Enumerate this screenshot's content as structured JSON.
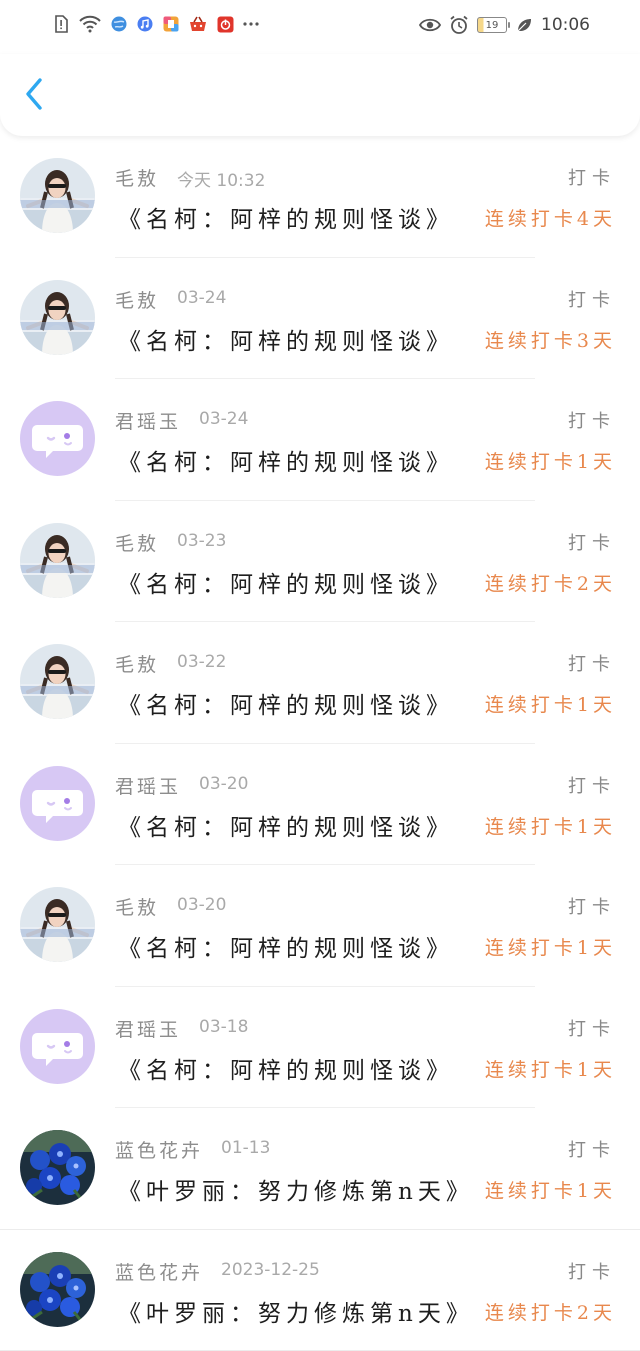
{
  "status_bar": {
    "left_icons": [
      "alert-icon",
      "wifi-icon",
      "globe-app-icon",
      "music-app-icon",
      "app-icon",
      "basket-app-icon",
      "netease-music-icon",
      "more-dots-icon"
    ],
    "right_icons": [
      "eye-icon",
      "alarm-icon",
      "battery-icon",
      "leaf-icon"
    ],
    "battery_level": "19",
    "time": "10:06"
  },
  "nav": {
    "back_icon": "chevron-left-icon",
    "accent_color": "#2ea8f0"
  },
  "colors": {
    "streak": "#e8884d",
    "name": "#8d8d8d",
    "title": "#1e1e1e"
  },
  "items": [
    {
      "user": "毛敖",
      "time": "今天 10:32",
      "label": "打卡",
      "title": "《名柯：阿梓的规则怪谈》",
      "streak": "连续打卡4天",
      "avatar": "photo-girl"
    },
    {
      "user": "毛敖",
      "time": "03-24",
      "label": "打卡",
      "title": "《名柯：阿梓的规则怪谈》",
      "streak": "连续打卡3天",
      "avatar": "photo-girl"
    },
    {
      "user": "君瑶玉",
      "time": "03-24",
      "label": "打卡",
      "title": "《名柯：阿梓的规则怪谈》",
      "streak": "连续打卡1天",
      "avatar": "default-chat"
    },
    {
      "user": "毛敖",
      "time": "03-23",
      "label": "打卡",
      "title": "《名柯：阿梓的规则怪谈》",
      "streak": "连续打卡2天",
      "avatar": "photo-girl"
    },
    {
      "user": "毛敖",
      "time": "03-22",
      "label": "打卡",
      "title": "《名柯：阿梓的规则怪谈》",
      "streak": "连续打卡1天",
      "avatar": "photo-girl"
    },
    {
      "user": "君瑶玉",
      "time": "03-20",
      "label": "打卡",
      "title": "《名柯：阿梓的规则怪谈》",
      "streak": "连续打卡1天",
      "avatar": "default-chat"
    },
    {
      "user": "毛敖",
      "time": "03-20",
      "label": "打卡",
      "title": "《名柯：阿梓的规则怪谈》",
      "streak": "连续打卡1天",
      "avatar": "photo-girl"
    },
    {
      "user": "君瑶玉",
      "time": "03-18",
      "label": "打卡",
      "title": "《名柯：阿梓的规则怪谈》",
      "streak": "连续打卡1天",
      "avatar": "default-chat"
    },
    {
      "user": "蓝色花卉",
      "time": "01-13",
      "label": "打卡",
      "title": "《叶罗丽：努力修炼第n天》",
      "streak": "连续打卡1天",
      "avatar": "photo-flowers"
    },
    {
      "user": "蓝色花卉",
      "time": "2023-12-25",
      "label": "打卡",
      "title": "《叶罗丽：努力修炼第n天》",
      "streak": "连续打卡2天",
      "avatar": "photo-flowers"
    }
  ]
}
